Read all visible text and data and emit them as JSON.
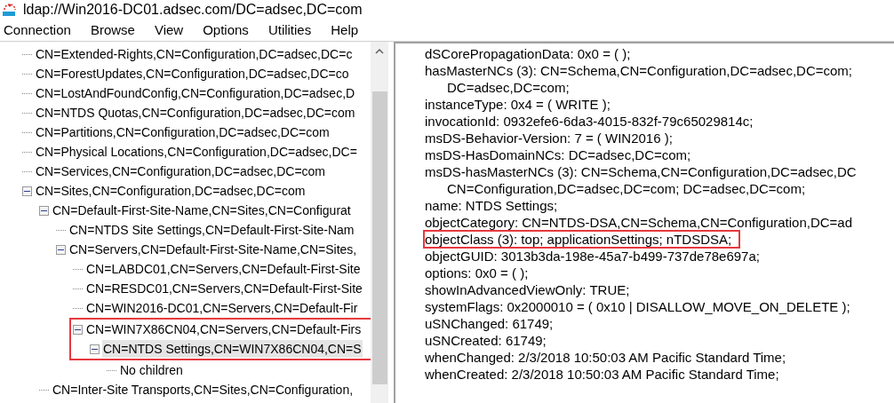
{
  "window": {
    "title": "ldap://Win2016-DC01.adsec.com/DC=adsec,DC=com"
  },
  "menu": [
    "Connection",
    "Browse",
    "View",
    "Options",
    "Utilities",
    "Help"
  ],
  "tree": [
    {
      "label": "CN=Extended-Rights,CN=Configuration,DC=adsec,DC=c",
      "selected": false,
      "highlighted": false
    },
    {
      "label": "CN=ForestUpdates,CN=Configuration,DC=adsec,DC=co",
      "selected": false,
      "highlighted": false
    },
    {
      "label": "CN=LostAndFoundConfig,CN=Configuration,DC=adsec,D",
      "selected": false,
      "highlighted": false
    },
    {
      "label": "CN=NTDS Quotas,CN=Configuration,DC=adsec,DC=com",
      "selected": false,
      "highlighted": false
    },
    {
      "label": "CN=Partitions,CN=Configuration,DC=adsec,DC=com",
      "selected": false,
      "highlighted": false
    },
    {
      "label": "CN=Physical Locations,CN=Configuration,DC=adsec,DC=",
      "selected": false,
      "highlighted": false
    },
    {
      "label": "CN=Services,CN=Configuration,DC=adsec,DC=com",
      "selected": false,
      "highlighted": false
    },
    {
      "label": "CN=Sites,CN=Configuration,DC=adsec,DC=com",
      "selected": false,
      "highlighted": false,
      "expanded": true,
      "children": [
        {
          "label": "CN=Default-First-Site-Name,CN=Sites,CN=Configurat",
          "selected": false,
          "highlighted": false,
          "expanded": true,
          "children": [
            {
              "label": "CN=NTDS Site Settings,CN=Default-First-Site-Nam",
              "selected": false,
              "highlighted": false
            },
            {
              "label": "CN=Servers,CN=Default-First-Site-Name,CN=Sites,",
              "selected": false,
              "highlighted": false,
              "expanded": true,
              "children": [
                {
                  "label": "CN=LABDC01,CN=Servers,CN=Default-First-Site",
                  "selected": false,
                  "highlighted": false
                },
                {
                  "label": "CN=RESDC01,CN=Servers,CN=Default-First-Site",
                  "selected": false,
                  "highlighted": false
                },
                {
                  "label": "CN=WIN2016-DC01,CN=Servers,CN=Default-Fir",
                  "selected": false,
                  "highlighted": false
                },
                {
                  "label": "CN=WIN7X86CN04,CN=Servers,CN=Default-Firs",
                  "selected": false,
                  "highlighted": true,
                  "expanded": true,
                  "children": [
                    {
                      "label": "CN=NTDS Settings,CN=WIN7X86CN04,CN=S",
                      "selected": true,
                      "highlighted": true,
                      "expanded": true,
                      "children": [
                        {
                          "label": "No children",
                          "selected": false,
                          "highlighted": false
                        }
                      ]
                    }
                  ]
                }
              ]
            }
          ]
        },
        {
          "label": "CN=Inter-Site Transports,CN=Sites,CN=Configuration,",
          "selected": false,
          "highlighted": false
        }
      ]
    }
  ],
  "attributes": [
    {
      "kind": "attribute",
      "text": "dSCorePropagationData: 0x0 = (  );",
      "highlighted": false
    },
    {
      "kind": "attribute",
      "text": "hasMasterNCs (3): CN=Schema,CN=Configuration,DC=adsec,DC=com;",
      "highlighted": false
    },
    {
      "kind": "continuation",
      "text": "DC=adsec,DC=com;",
      "highlighted": false
    },
    {
      "kind": "attribute",
      "text": "instanceType: 0x4 = ( WRITE );",
      "highlighted": false
    },
    {
      "kind": "attribute",
      "text": "invocationId: 0932efe6-6da3-4015-832f-79c65029814c;",
      "highlighted": false
    },
    {
      "kind": "attribute",
      "text": "msDS-Behavior-Version: 7 = ( WIN2016 );",
      "highlighted": false
    },
    {
      "kind": "attribute",
      "text": "msDS-HasDomainNCs: DC=adsec,DC=com;",
      "highlighted": false
    },
    {
      "kind": "attribute",
      "text": "msDS-hasMasterNCs (3): CN=Schema,CN=Configuration,DC=adsec,DC",
      "highlighted": false
    },
    {
      "kind": "continuation",
      "text": "CN=Configuration,DC=adsec,DC=com; DC=adsec,DC=com;",
      "highlighted": false
    },
    {
      "kind": "attribute",
      "text": "name: NTDS Settings;",
      "highlighted": false
    },
    {
      "kind": "attribute",
      "text": "objectCategory: CN=NTDS-DSA,CN=Schema,CN=Configuration,DC=ad",
      "highlighted": false
    },
    {
      "kind": "attribute",
      "text": "objectClass (3): top; applicationSettings; nTDSDSA;",
      "highlighted": true
    },
    {
      "kind": "attribute",
      "text": "objectGUID: 3013b3da-198e-45a7-b499-737de78e697a;",
      "highlighted": false
    },
    {
      "kind": "attribute",
      "text": "options: 0x0 = (  );",
      "highlighted": false
    },
    {
      "kind": "attribute",
      "text": "showInAdvancedViewOnly: TRUE;",
      "highlighted": false
    },
    {
      "kind": "attribute",
      "text": "systemFlags: 0x2000010 = ( 0x10 | DISALLOW_MOVE_ON_DELETE );",
      "highlighted": false
    },
    {
      "kind": "attribute",
      "text": "uSNChanged: 61749;",
      "highlighted": false
    },
    {
      "kind": "attribute",
      "text": "uSNCreated: 61749;",
      "highlighted": false
    },
    {
      "kind": "attribute",
      "text": "whenChanged: 2/3/2018 10:50:03 AM Pacific Standard Time;",
      "highlighted": false
    },
    {
      "kind": "attribute",
      "text": "whenCreated: 2/3/2018 10:50:03 AM Pacific Standard Time;",
      "highlighted": false
    }
  ]
}
